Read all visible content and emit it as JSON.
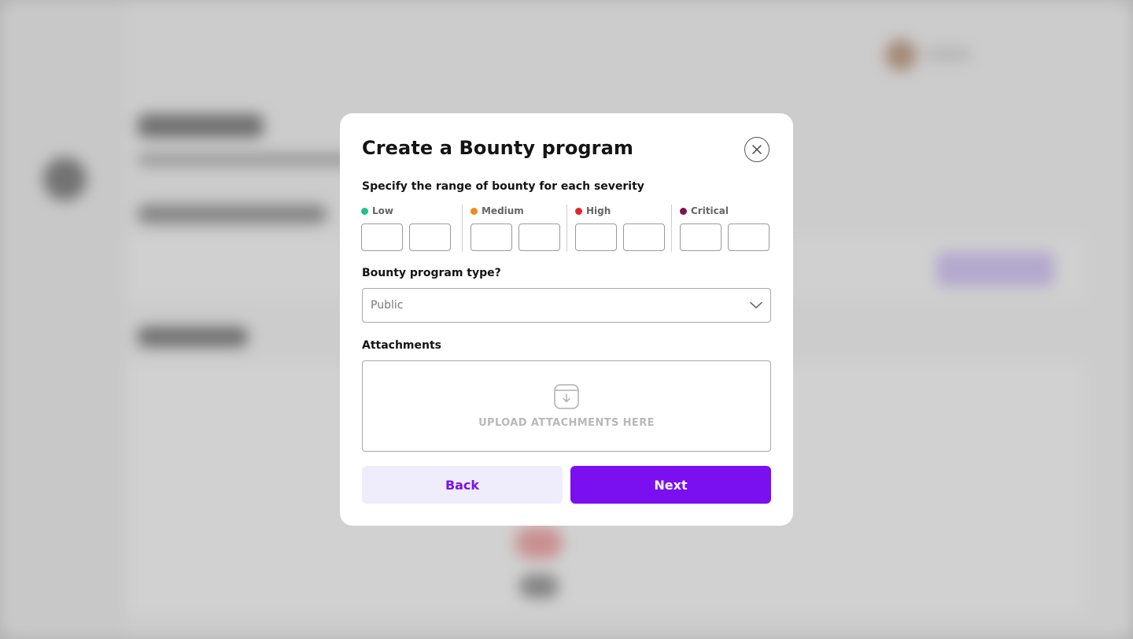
{
  "modal": {
    "title": "Create a Bounty program",
    "subtitle": "Specify the range of bounty for each severity",
    "severities": [
      {
        "label": "Low",
        "color": "#1ec28b",
        "min": "",
        "max": ""
      },
      {
        "label": "Medium",
        "color": "#f5871f",
        "min": "",
        "max": ""
      },
      {
        "label": "High",
        "color": "#e5242a",
        "min": "",
        "max": ""
      },
      {
        "label": "Critical",
        "color": "#7d1450",
        "min": "",
        "max": ""
      }
    ],
    "program_type_label": "Bounty program type?",
    "program_type_value": "Public",
    "attachments_label": "Attachments",
    "upload_text": "UPLOAD ATTACHMENTS HERE",
    "back_label": "Back",
    "next_label": "Next"
  },
  "colors": {
    "accent": "#7a0ff0",
    "accent_light": "#efedfc"
  },
  "icons": {
    "close": "close-icon",
    "chevron": "chevron-down-icon",
    "upload": "download-tray-icon"
  }
}
